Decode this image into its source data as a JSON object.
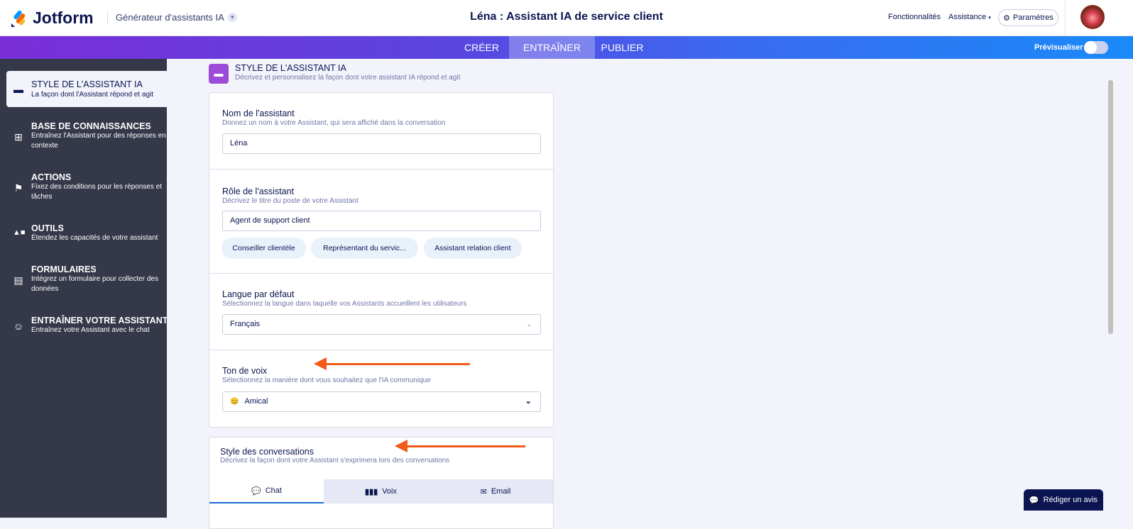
{
  "header": {
    "logo": "Jotform",
    "product": "Générateur d'assistants IA",
    "title": "Léna : Assistant IA de service client",
    "links": [
      "Fonctionnalités",
      "Assistance"
    ],
    "settings": "Paramètres"
  },
  "nav": {
    "tabs": [
      "CRÉER",
      "ENTRAÎNER",
      "PUBLIER"
    ],
    "active": "ENTRAÎNER",
    "preview": "Prévisualiser",
    "preview_on": false
  },
  "sidebar": [
    {
      "title": "STYLE DE L'ASSISTANT IA",
      "sub": "La façon dont l'Assistant répond et agit"
    },
    {
      "title": "BASE DE CONNAISSANCES",
      "sub": "Entraînez l'Assistant pour des réponses en contexte"
    },
    {
      "title": "ACTIONS",
      "sub": "Fixez des conditions pour les réponses et tâches"
    },
    {
      "title": "OUTILS",
      "sub": "Étendez les capacités de votre assistant"
    },
    {
      "title": "FORMULAIRES",
      "sub": "Intégrez un formulaire pour collecter des données"
    },
    {
      "title": "ENTRAÎNER VOTRE ASSISTANT",
      "sub": "Entraînez votre Assistant avec le chat"
    }
  ],
  "page": {
    "title": "STYLE DE L'ASSISTANT IA",
    "sub": "Décrivez et personnalisez la façon dont votre assistant IA répond et agit"
  },
  "fields": {
    "name": {
      "label": "Nom de l'assistant",
      "desc": "Donnez un nom à votre Assistant, qui sera affiché dans la conversation",
      "value": "Léna"
    },
    "role": {
      "label": "Rôle de l'assistant",
      "desc": "Décrivez le titre du poste de votre Assistant",
      "value": "Agent de support client",
      "chips": [
        "Conseiller clientèle",
        "Représentant du servic...",
        "Assistant relation client"
      ]
    },
    "lang": {
      "label": "Langue par défaut",
      "desc": "Sélectionnez la langue dans laquelle vos Assistants accueillent les utilisateurs",
      "value": "Français"
    },
    "tone": {
      "label": "Ton de voix",
      "desc": "Sélectionnez la manière dont vous souhaitez que l'IA communique",
      "value": "Amical",
      "emoji": "😊"
    }
  },
  "conv": {
    "label": "Style des conversations",
    "desc": "Décrivez la façon dont votre Assistant s'exprimera lors des conversations",
    "tabs": [
      "Chat",
      "Voix",
      "Email"
    ]
  },
  "review": "Rédiger un avis",
  "colors": {
    "accent": "#0a1551",
    "arrow": "#f05a1a",
    "sidebar": "#343849"
  }
}
